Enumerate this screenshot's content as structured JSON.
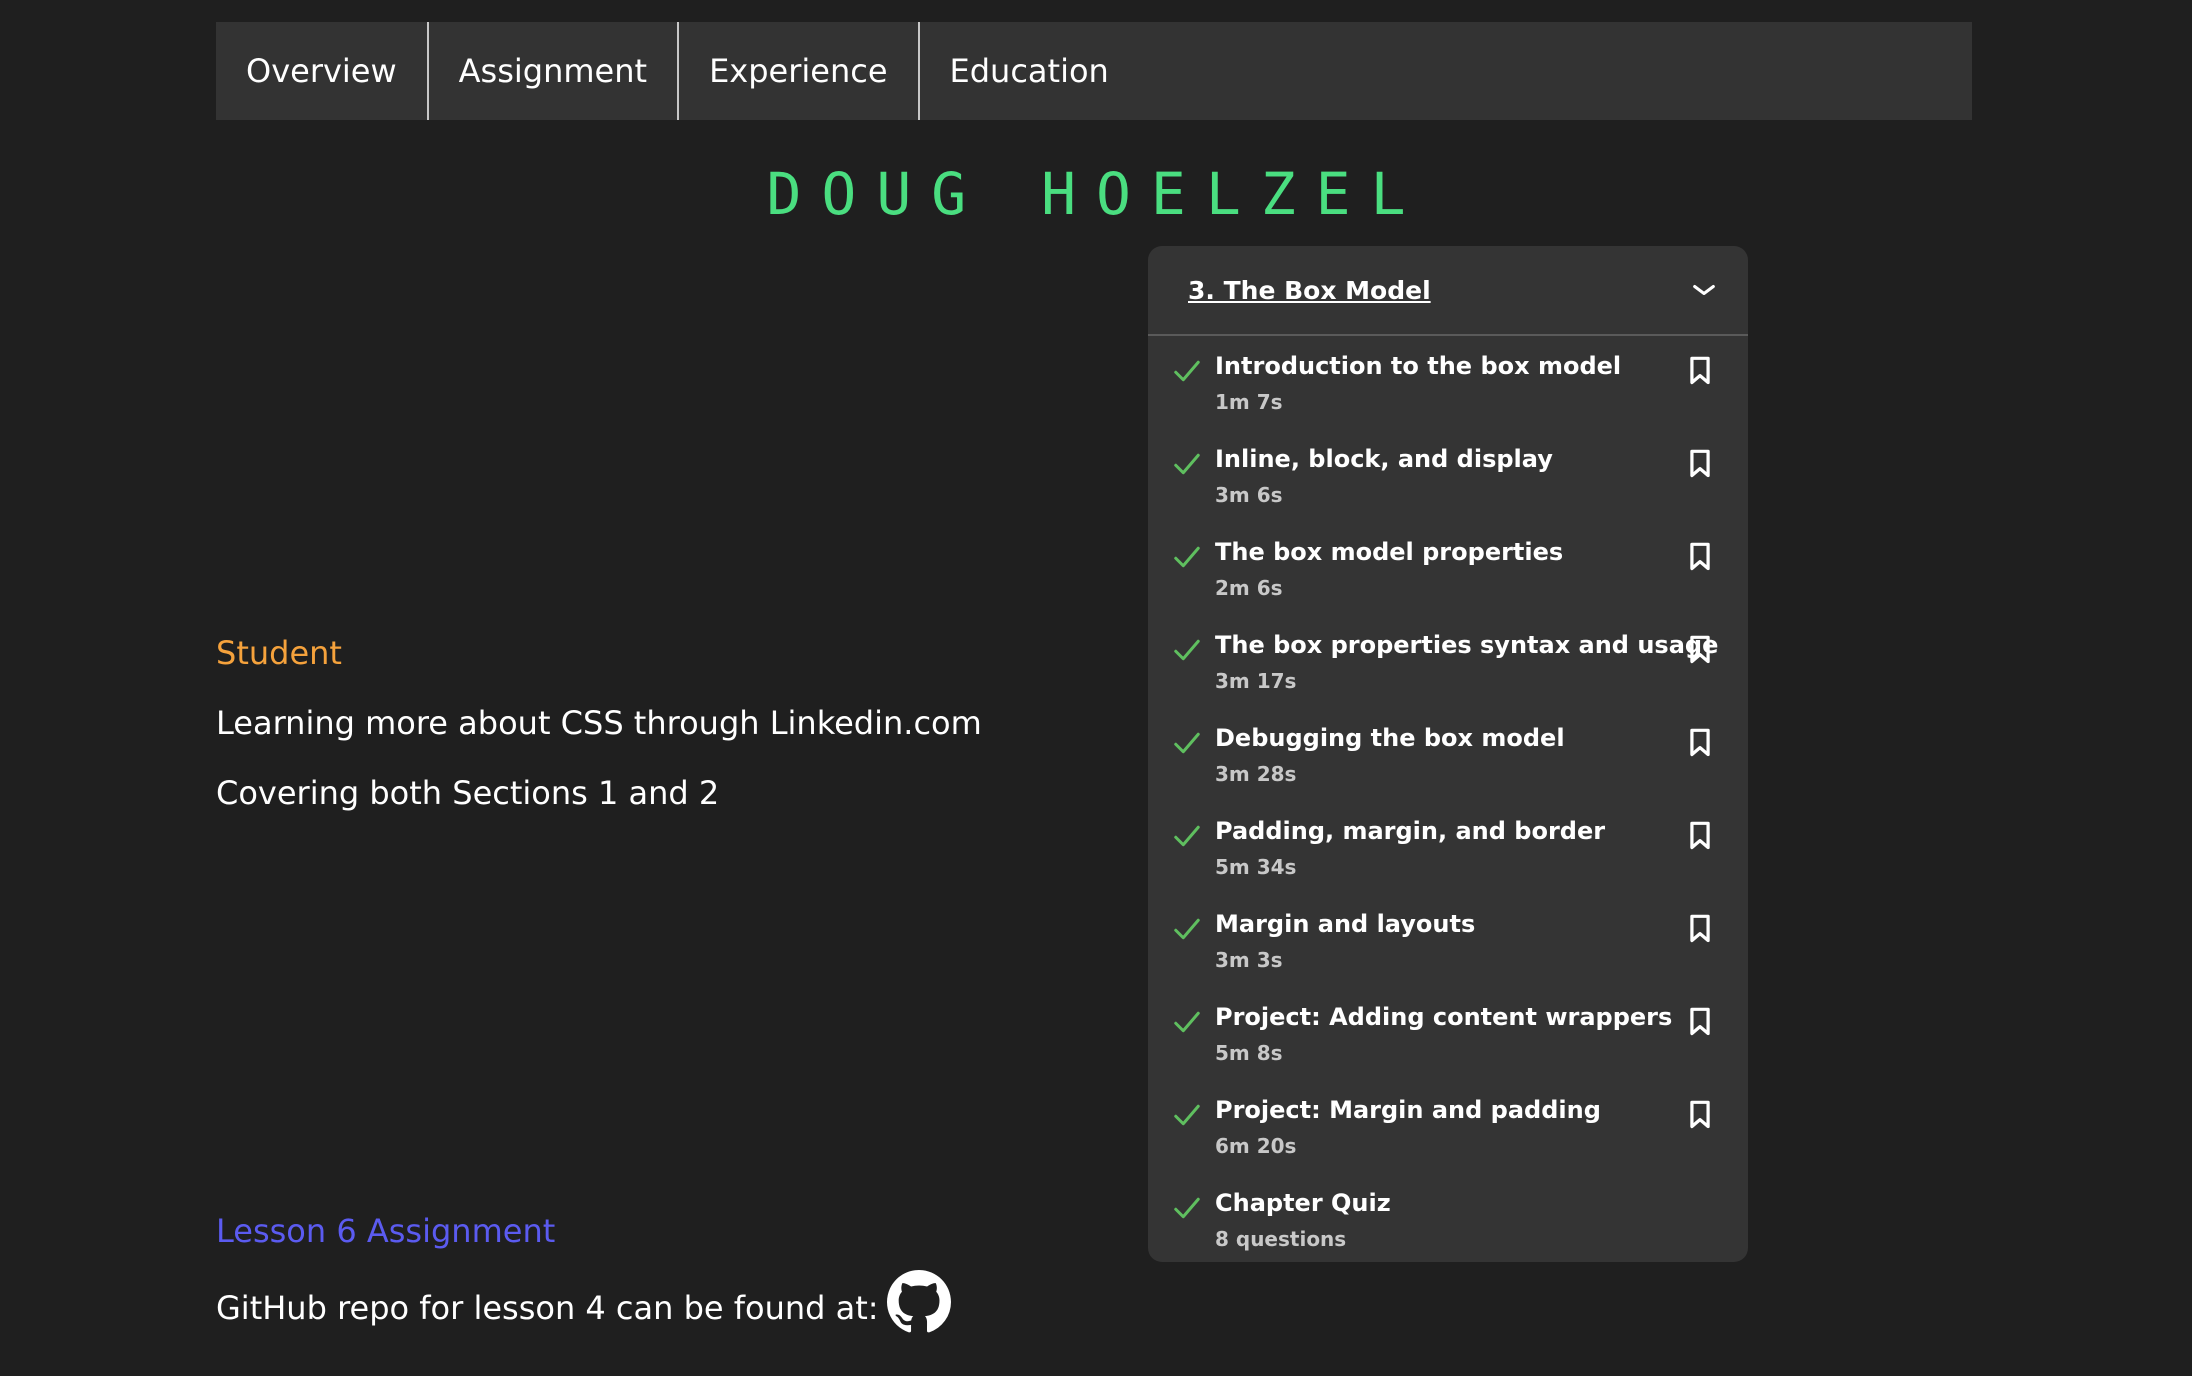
{
  "nav": {
    "items": [
      {
        "label": "Overview"
      },
      {
        "label": "Assignment"
      },
      {
        "label": "Experience"
      },
      {
        "label": "Education"
      }
    ]
  },
  "header": {
    "name": "DOUG HOELZEL"
  },
  "main": {
    "role": "Student",
    "description_1": "Learning more about CSS through Linkedin.com",
    "description_2": "Covering both Sections 1 and 2",
    "lesson_link": "Lesson 6 Assignment",
    "github_text": "GitHub repo for lesson 4 can be found at:",
    "github_icon": "github-icon"
  },
  "course": {
    "section_title": "3. The Box Model",
    "lessons": [
      {
        "title": "Introduction to the box model",
        "meta": "1m 7s",
        "completed": true,
        "bookmark": true
      },
      {
        "title": "Inline, block, and display",
        "meta": "3m 6s",
        "completed": true,
        "bookmark": true
      },
      {
        "title": "The box model properties",
        "meta": "2m 6s",
        "completed": true,
        "bookmark": true
      },
      {
        "title": "The box properties syntax and usage",
        "meta": "3m 17s",
        "completed": true,
        "bookmark": true
      },
      {
        "title": "Debugging the box model",
        "meta": "3m 28s",
        "completed": true,
        "bookmark": true
      },
      {
        "title": "Padding, margin, and border",
        "meta": "5m 34s",
        "completed": true,
        "bookmark": true
      },
      {
        "title": "Margin and layouts",
        "meta": "3m 3s",
        "completed": true,
        "bookmark": true
      },
      {
        "title": "Project: Adding content wrappers",
        "meta": "5m 8s",
        "completed": true,
        "bookmark": true
      },
      {
        "title": "Project: Margin and padding",
        "meta": "6m 20s",
        "completed": true,
        "bookmark": true
      },
      {
        "title": "Chapter Quiz",
        "meta": "8 questions",
        "completed": true,
        "bookmark": false
      }
    ]
  },
  "colors": {
    "background": "#1f1f1f",
    "name": "#4ade80",
    "role": "#f5a23c",
    "link": "#5b5bf0",
    "panel": "#343434",
    "check": "#5fbf5f"
  }
}
